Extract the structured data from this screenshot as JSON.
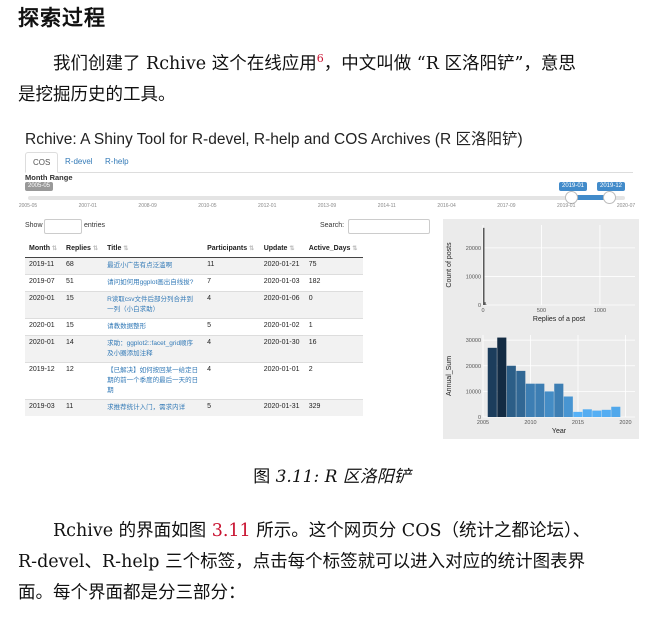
{
  "heading": "探索过程",
  "para1": {
    "text_a": "我们创建了 Rchive 这个在线应用",
    "footnote": "6",
    "text_b": "，中文叫做 “R 区洛阳铲”，意思",
    "line2": "是挖掘历史的工具。"
  },
  "app": {
    "title": "Rchive: A Shiny Tool for R-devel, R-help and COS Archives (R 区洛阳铲)",
    "tabs": [
      "COS",
      "R-devel",
      "R-help"
    ],
    "month_range_label": "Month Range",
    "slider": {
      "min_label": "2005-05",
      "from_label": "2019-01",
      "to_label": "2019-12",
      "ticks": [
        "2005-05",
        "2007-01",
        "2008-09",
        "2010-05",
        "2012-01",
        "2013-09",
        "2014-11",
        "2016-04",
        "2017-09",
        "2019-01",
        "2020-07"
      ]
    },
    "show_label": "Show",
    "entries_label": "entries",
    "search_label": "Search:",
    "columns": [
      "Month",
      "Replies",
      "Title",
      "Participants",
      "Update",
      "Active_Days"
    ],
    "rows": [
      [
        "2019-11",
        "68",
        "最近小广告有点泛滥啊",
        "11",
        "2020-01-21",
        "75"
      ],
      [
        "2019-07",
        "51",
        "请问如何用ggplot画出自线拔?",
        "7",
        "2020-01-03",
        "182"
      ],
      [
        "2020-01",
        "15",
        "R读取csv文件后部分列合并到一列（小白求助）",
        "4",
        "2020-01-06",
        "0"
      ],
      [
        "2020-01",
        "15",
        "请教数据整形",
        "5",
        "2020-01-02",
        "1"
      ],
      [
        "2020-01",
        "14",
        "求助：ggplot2::facet_grid顺序及小圈添加注释",
        "4",
        "2020-01-30",
        "16"
      ],
      [
        "2019-12",
        "12",
        "【已解决】如何按回某一给定日期的前一个季度的最后一天的日期",
        "4",
        "2020-01-01",
        "2"
      ],
      [
        "2019-03",
        "11",
        "求推荐统计入门，需求内详",
        "5",
        "2020-01-31",
        "329"
      ]
    ]
  },
  "chart_data": [
    {
      "type": "bar",
      "xlabel": "Replies of a post",
      "ylabel": "Count of posts",
      "x": [
        0,
        10,
        20
      ],
      "values": [
        27000,
        1000,
        120
      ],
      "xticks": [
        "0",
        "500",
        "1000"
      ],
      "yticks": [
        "0",
        "10000",
        "20000"
      ],
      "xlim": [
        0,
        1300
      ],
      "ylim": [
        0,
        28000
      ]
    },
    {
      "type": "bar",
      "xlabel": "Year",
      "ylabel": "Annual_Sum",
      "categories": [
        "2006",
        "2007",
        "2008",
        "2009",
        "2010",
        "2011",
        "2012",
        "2013",
        "2014",
        "2015",
        "2016",
        "2017",
        "2018",
        "2019"
      ],
      "values": [
        27000,
        31000,
        20000,
        18000,
        13000,
        13000,
        10000,
        13000,
        8000,
        2000,
        3000,
        2500,
        2800,
        4000
      ],
      "xticks": [
        "2005",
        "2010",
        "2015",
        "2020"
      ],
      "yticks": [
        "0",
        "10000",
        "20000",
        "30000"
      ],
      "xlim": [
        2005,
        2021
      ],
      "ylim": [
        0,
        32000
      ],
      "colors": [
        "#132b43",
        "#56b1f7"
      ]
    }
  ],
  "caption": {
    "prefix": "图 ",
    "number": "3.11:",
    "text": " R 区洛阳铲"
  },
  "para2": {
    "a": "Rchive 的界面如图 ",
    "ref": "3.11",
    "b": " 所示。这个网页分 COS（统计之都论坛）、",
    "line2": "R-devel、R-help 三个标签，点击每个标签就可以进入对应的统计图表界",
    "line3": "面。每个界面都是分三部分："
  }
}
